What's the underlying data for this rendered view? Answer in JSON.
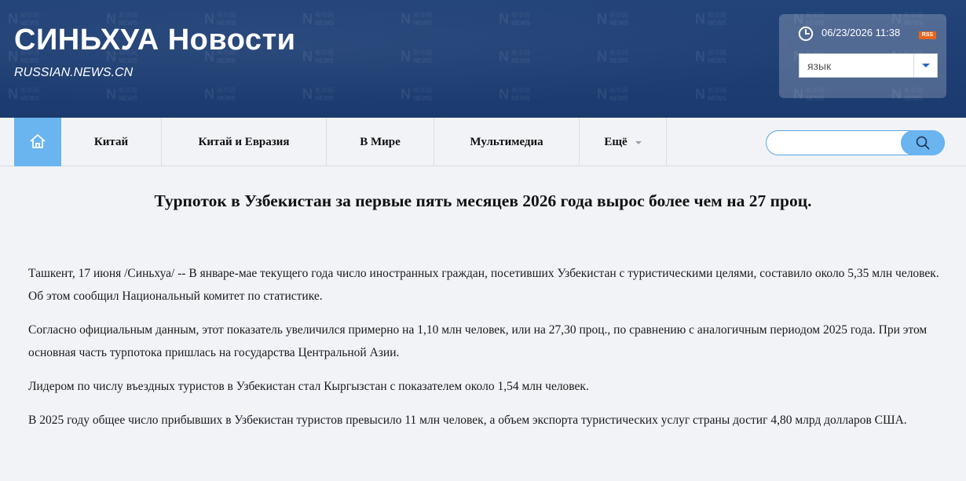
{
  "header": {
    "title": "СИНЬХУА Новости",
    "subtitle": "RUSSIAN.NEWS.CN",
    "datetime": "06/23/2026 11:38",
    "rss_label": "RSS",
    "language_select": {
      "selected": "язык"
    }
  },
  "nav": {
    "home_icon": "home-icon",
    "items": [
      {
        "label": "Китай"
      },
      {
        "label": "Китай и Евразия"
      },
      {
        "label": "В Мире"
      },
      {
        "label": "Мультимедиа"
      },
      {
        "label": "Ещё"
      }
    ],
    "search": {
      "placeholder": "",
      "value": "",
      "icon": "search-icon"
    }
  },
  "article": {
    "headline": "Турпоток в Узбекистан за первые пять месяцев 2026 года вырос более чем на 27 проц.",
    "paragraphs": [
      "Ташкент, 17 июня /Синьхуа/ -- В январе-мае текущего года число иностранных граждан, посетивших Узбекистан с туристическими целями, составило около 5,35 млн человек. Об этом сообщил Национальный комитет по статистике.",
      "Согласно официальным данным, этот показатель увеличился примерно на 1,10 млн человек, или на 27,30 проц., по сравнению с аналогичным периодом 2025 года. При этом основная часть турпотока пришлась на государства Центральной Азии.",
      "Лидером по числу въездных туристов в Узбекистан стал Кыргызстан с показателем около 1,54 млн человек.",
      "В 2025 году общее число прибывших в Узбекистан туристов превысило 11 млн человек, а объем экспорта туристических услуг страны достиг 4,80 млрд долларов США."
    ]
  },
  "colors": {
    "header_bg": "#1e3d72",
    "accent": "#6ab4ef",
    "rss": "#e8651a",
    "page_bg": "#f1f3f7"
  }
}
